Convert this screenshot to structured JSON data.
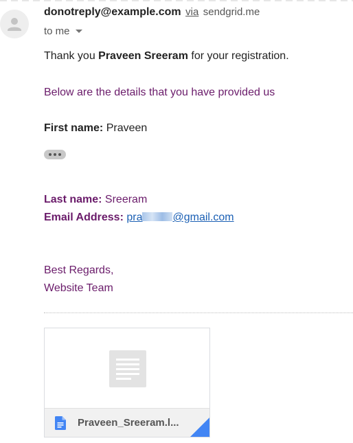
{
  "header": {
    "sender_email": "donotreply@example.com",
    "via_label": "via",
    "via_domain": "sendgrid.me",
    "recipient_label": "to me"
  },
  "body": {
    "thanks_prefix": "Thank you ",
    "thanks_name": "Praveen Sreeram",
    "thanks_suffix": " for your registration.",
    "intro": "Below are the details that you have provided us",
    "first_name_label": "First name:",
    "first_name_value": " Praveen",
    "last_name_label": "Last name:",
    "last_name_value": " Sreeram",
    "email_label": "Email Address:",
    "email_prefix": "pra",
    "email_suffix": "@gmail.com",
    "regards": "Best Regards,",
    "team": "Website Team"
  },
  "attachment": {
    "file_name": "Praveen_Sreeram.l...",
    "icon": "google-docs-icon"
  },
  "colors": {
    "body_purple": "#6a1b6a",
    "link_blue": "#1a5fb4",
    "doc_icon_blue": "#4285f4"
  }
}
